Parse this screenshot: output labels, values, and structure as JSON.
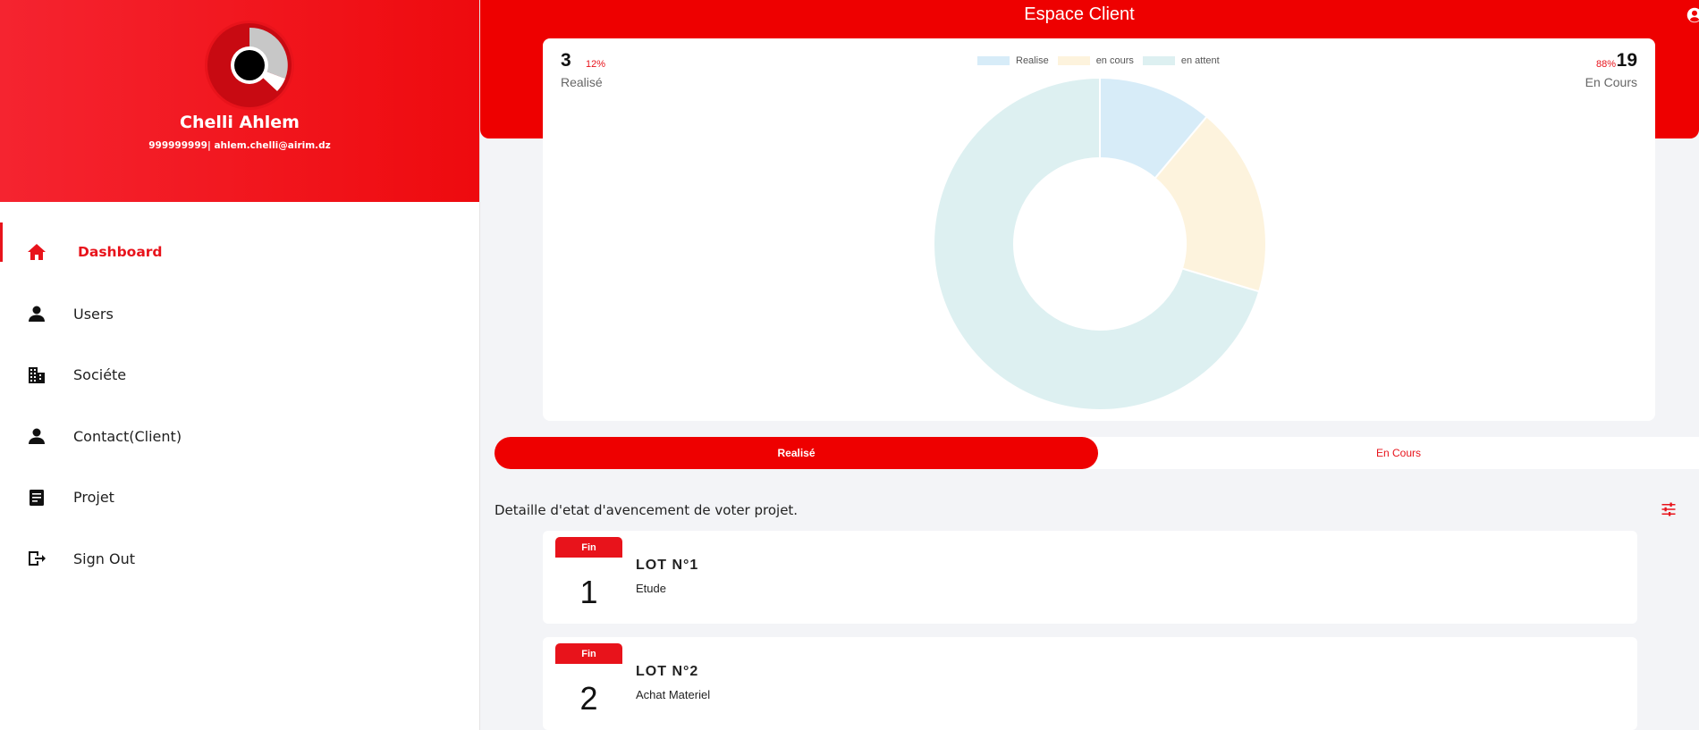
{
  "colors": {
    "brand": "#ee0000",
    "accent": "#e8131b",
    "realise": "#d7ecf8",
    "en_cours": "#fdf3dd",
    "en_attent": "#ddf0f1"
  },
  "profile": {
    "name": "Chelli Ahlem",
    "contact": "999999999| ahlem.chelli@airim.dz"
  },
  "sidebar": {
    "items": [
      {
        "label": "Dashboard",
        "icon": "home-icon",
        "active": true
      },
      {
        "label": "Users",
        "icon": "person-icon",
        "active": false
      },
      {
        "label": "Sociéte",
        "icon": "building-icon",
        "active": false
      },
      {
        "label": "Contact(Client)",
        "icon": "person-icon",
        "active": false
      },
      {
        "label": "Projet",
        "icon": "document-icon",
        "active": false
      },
      {
        "label": "Sign Out",
        "icon": "sign-out-icon",
        "active": false
      }
    ]
  },
  "header": {
    "title": "Espace Client"
  },
  "stats": {
    "left": {
      "value": "3",
      "percent": "12%",
      "label": "Realisé"
    },
    "right": {
      "value": "19",
      "percent": "88%",
      "label": "En Cours"
    }
  },
  "chart_data": {
    "type": "pie",
    "donut": true,
    "legend_position": "top",
    "series": [
      {
        "name": "Realise",
        "value": 3,
        "color": "#d7ecf8"
      },
      {
        "name": "en cours",
        "value": 5,
        "color": "#fdf3dd"
      },
      {
        "name": "en attent",
        "value": 19,
        "color": "#ddf0f1"
      }
    ]
  },
  "toggle": {
    "active_label": "Realisé",
    "inactive_label": "En Cours"
  },
  "section": {
    "title": "Detaille d'etat d'avencement de voter projet."
  },
  "lots": [
    {
      "badge": "Fin",
      "number": "1",
      "title": "LOT N°1",
      "subtitle": "Etude"
    },
    {
      "badge": "Fin",
      "number": "2",
      "title": "LOT N°2",
      "subtitle": "Achat Materiel"
    }
  ]
}
